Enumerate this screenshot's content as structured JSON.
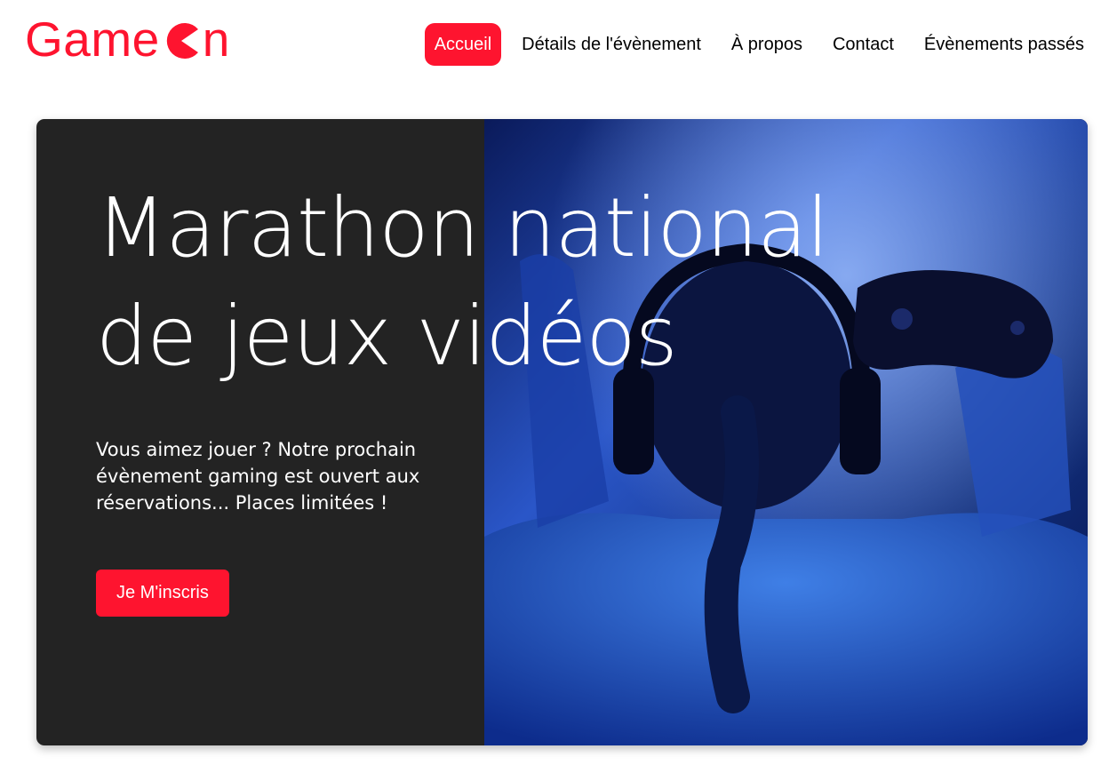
{
  "brand": {
    "logo_prefix": "Game",
    "logo_suffix": "n",
    "accent_color": "#fe142f"
  },
  "nav": {
    "items": [
      {
        "label": "Accueil",
        "active": true
      },
      {
        "label": "Détails de l'évènement",
        "active": false
      },
      {
        "label": "À propos",
        "active": false
      },
      {
        "label": "Contact",
        "active": false
      },
      {
        "label": "Évènements passés",
        "active": false
      }
    ]
  },
  "hero": {
    "title": "Marathon national de jeux vidéos",
    "subtitle": "Vous aimez jouer ? Notre prochain évènement gaming est ouvert aux réservations... Places limitées !",
    "cta_label": "Je M'inscris",
    "image_icon": "gamer-with-headphones-photo"
  }
}
